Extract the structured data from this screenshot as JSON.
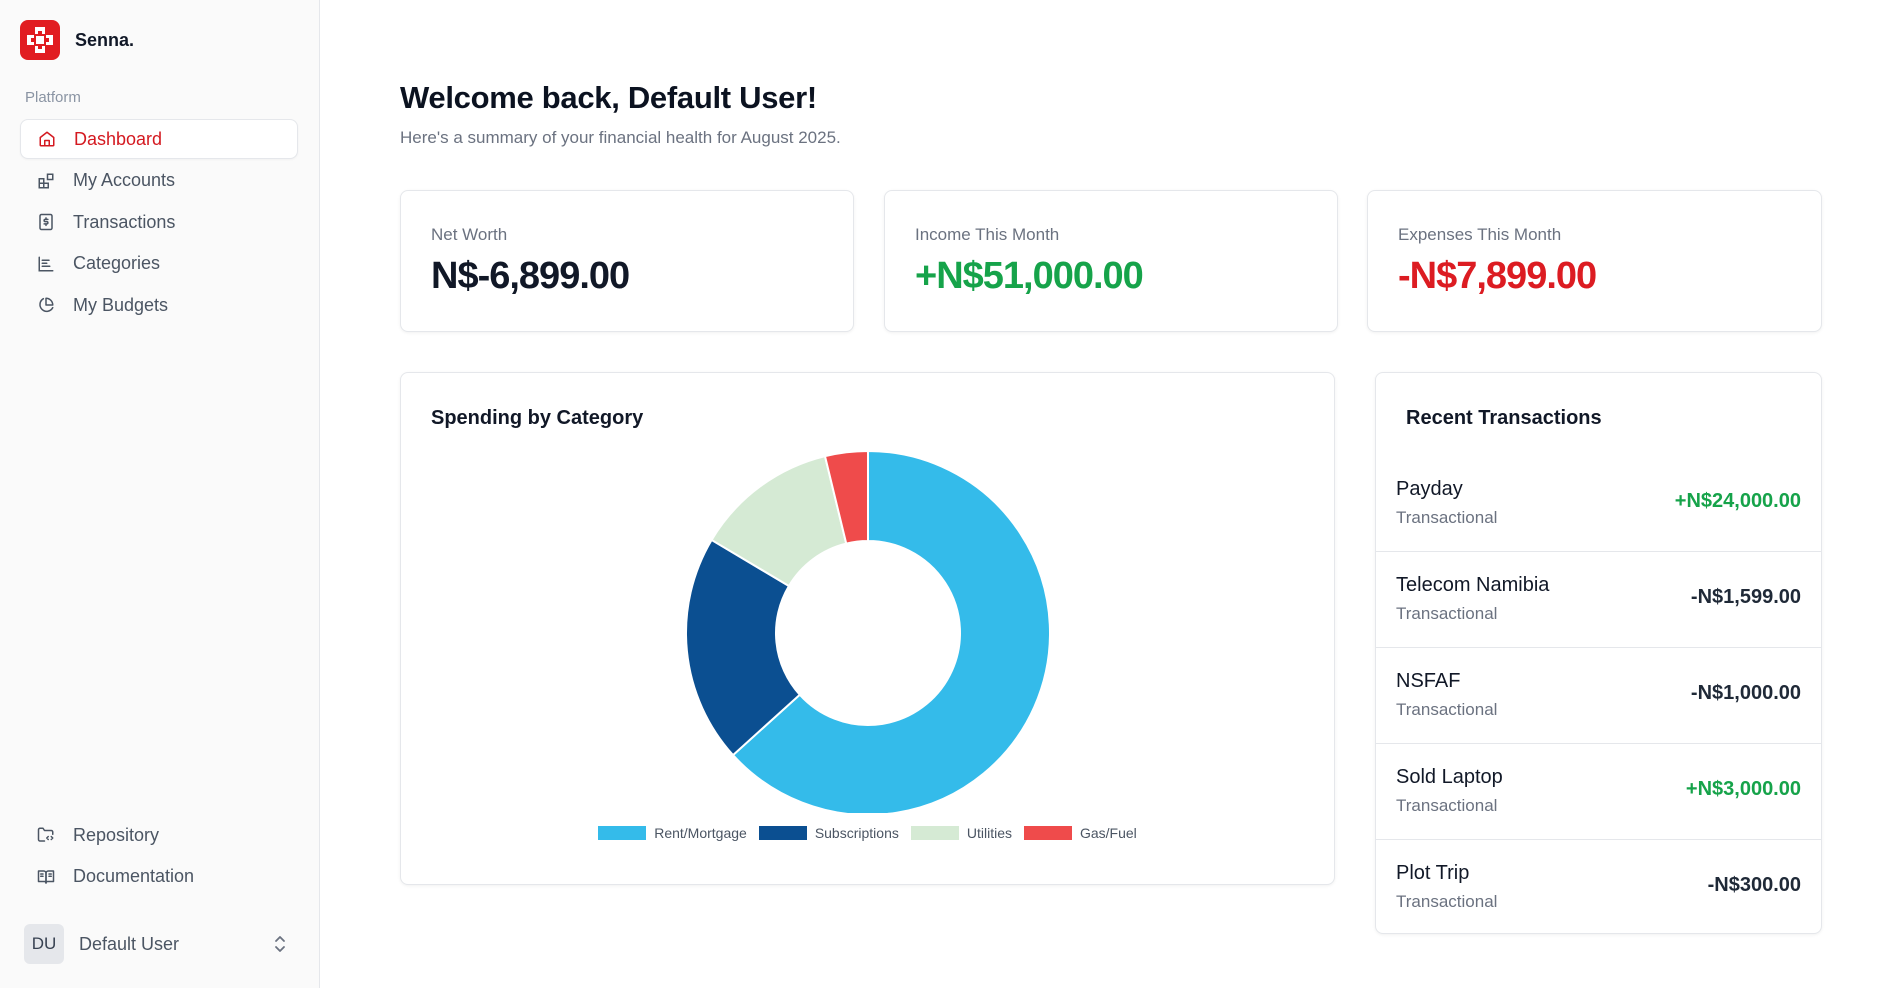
{
  "app": {
    "name": "Senna."
  },
  "sidebar": {
    "section_label": "Platform",
    "items": [
      {
        "label": "Dashboard",
        "icon": "home-icon",
        "active": true
      },
      {
        "label": "My Accounts",
        "icon": "grid-icon",
        "active": false
      },
      {
        "label": "Transactions",
        "icon": "dollar-receipt-icon",
        "active": false
      },
      {
        "label": "Categories",
        "icon": "list-icon",
        "active": false
      },
      {
        "label": "My Budgets",
        "icon": "pie-chart-icon",
        "active": false
      }
    ],
    "bottom_items": [
      {
        "label": "Repository",
        "icon": "folder-code-icon"
      },
      {
        "label": "Documentation",
        "icon": "book-icon"
      }
    ],
    "user": {
      "initials": "DU",
      "name": "Default User"
    }
  },
  "header": {
    "title": "Welcome back, Default User!",
    "subtitle": "Here's a summary of your financial health for August 2025."
  },
  "stats": [
    {
      "label": "Net Worth",
      "value": "N$-6,899.00",
      "color": "#111827"
    },
    {
      "label": "Income This Month",
      "value": "+N$51,000.00",
      "color": "#16a34a"
    },
    {
      "label": "Expenses This Month",
      "value": "-N$7,899.00",
      "color": "#dc1c22"
    }
  ],
  "spending": {
    "title": "Spending by Category"
  },
  "chart_data": {
    "type": "pie",
    "title": "Spending by Category",
    "categories": [
      "Rent/Mortgage",
      "Subscriptions",
      "Utilities",
      "Gas/Fuel"
    ],
    "values": [
      5000,
      1599,
      1000,
      300
    ],
    "colors": [
      "#34bbea",
      "#0b4f91",
      "#d5ead4",
      "#ef4b4b"
    ],
    "donut": true,
    "legend_position": "bottom"
  },
  "recent": {
    "title": "Recent Transactions",
    "items": [
      {
        "name": "Payday",
        "type": "Transactional",
        "amount": "+N$24,000.00",
        "positive": true
      },
      {
        "name": "Telecom Namibia",
        "type": "Transactional",
        "amount": "-N$1,599.00",
        "positive": false
      },
      {
        "name": "NSFAF",
        "type": "Transactional",
        "amount": "-N$1,000.00",
        "positive": false
      },
      {
        "name": "Sold Laptop",
        "type": "Transactional",
        "amount": "+N$3,000.00",
        "positive": true
      },
      {
        "name": "Plot Trip",
        "type": "Transactional",
        "amount": "-N$300.00",
        "positive": false
      }
    ]
  }
}
